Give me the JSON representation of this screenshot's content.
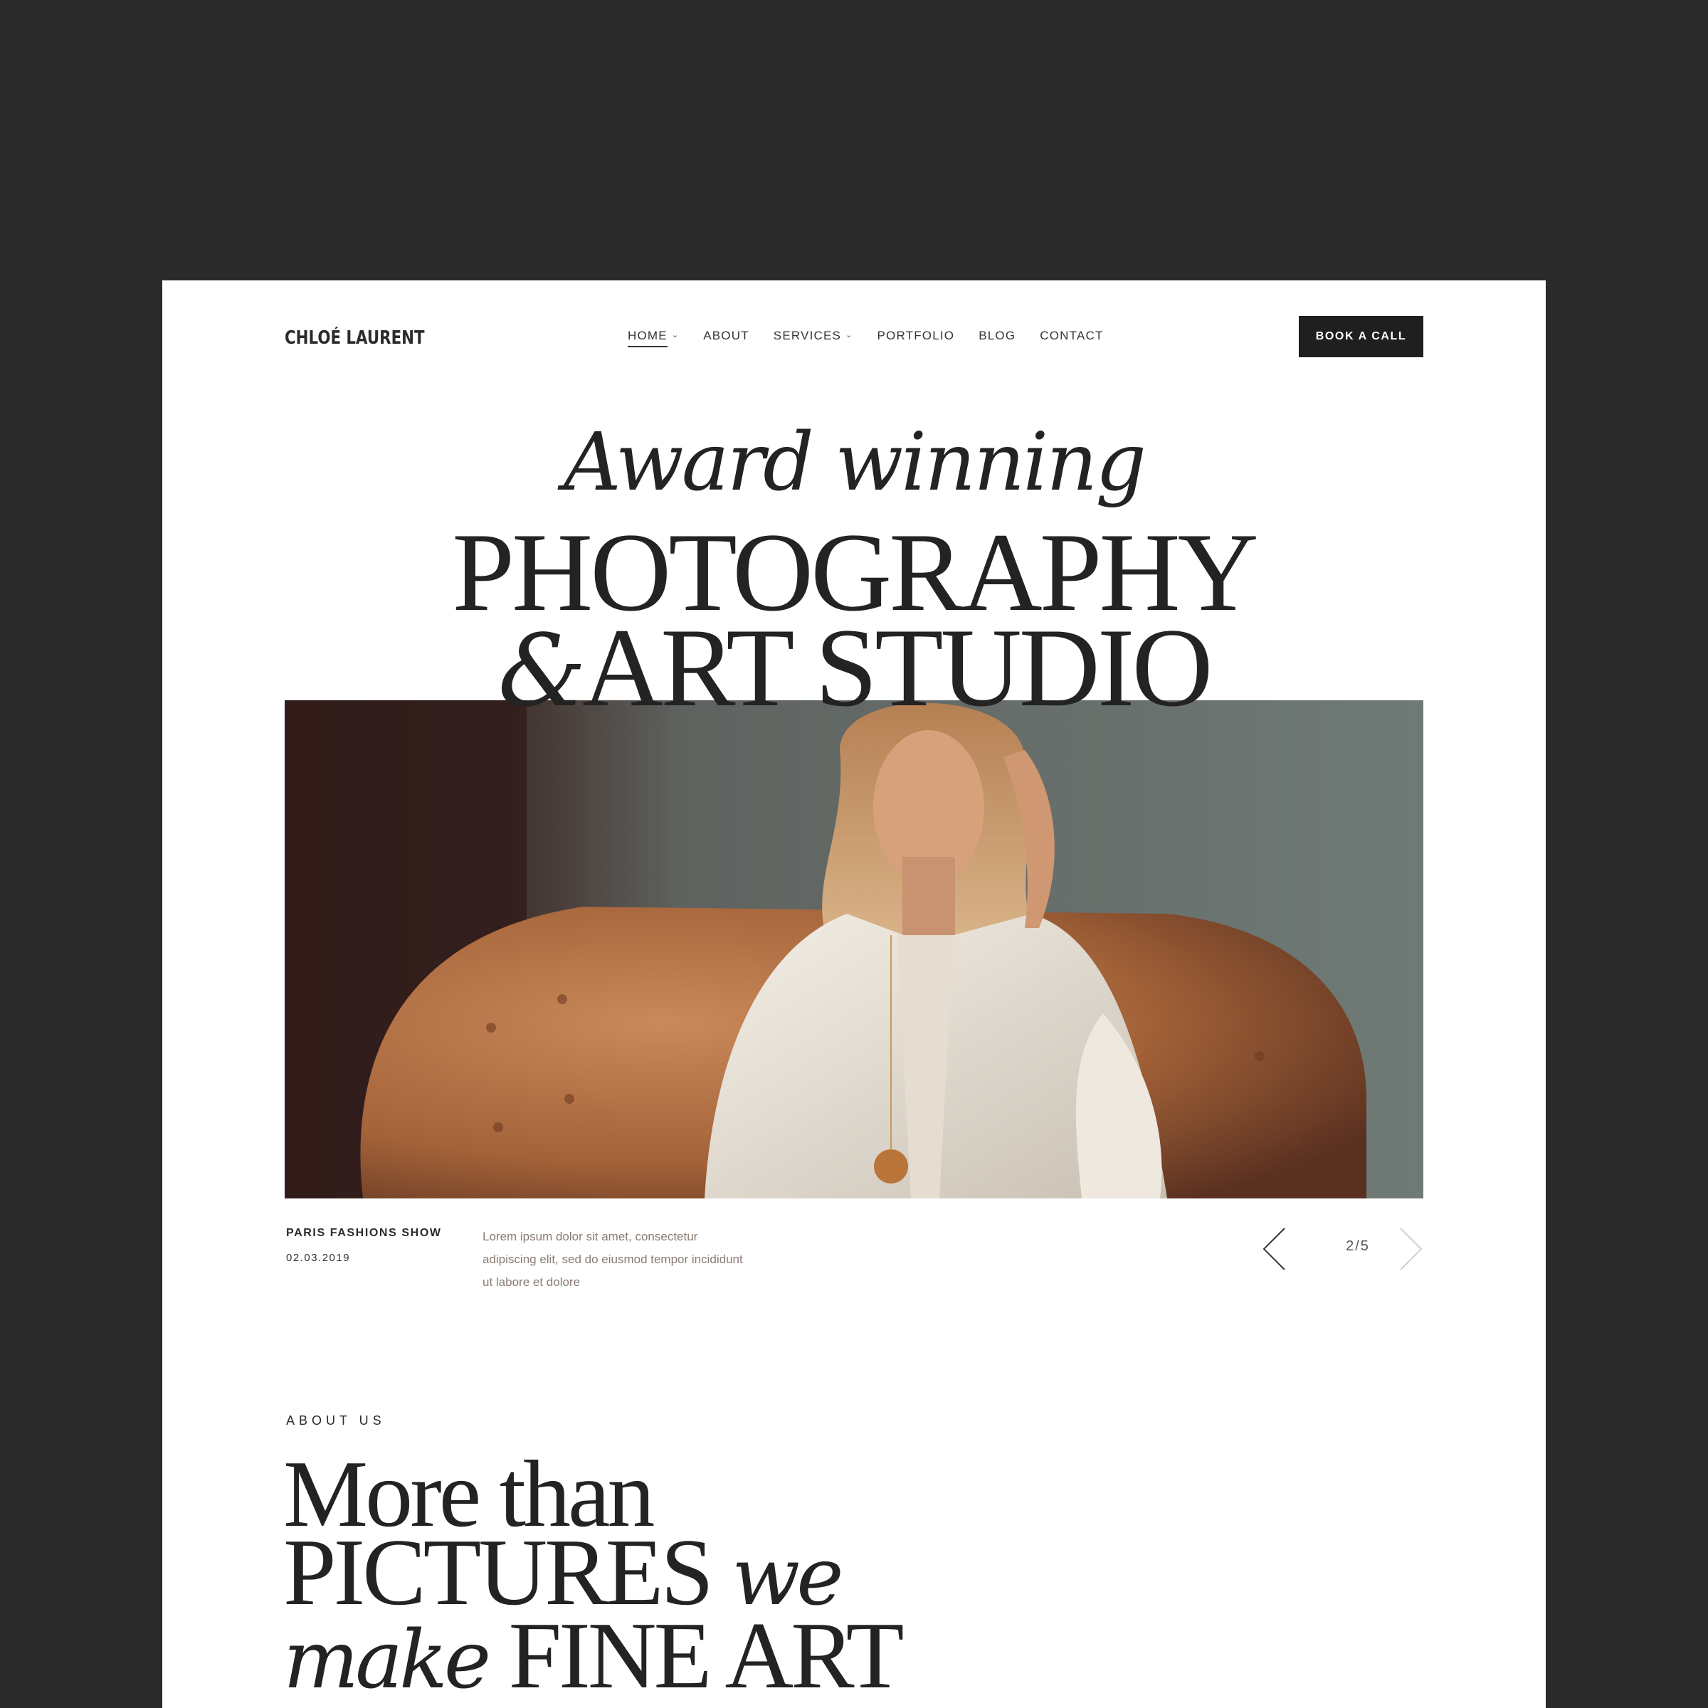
{
  "brand": "CHLOÉ LAURENT",
  "nav": [
    {
      "label": "HOME",
      "dropdown": true,
      "active": true
    },
    {
      "label": "ABOUT",
      "dropdown": false
    },
    {
      "label": "SERVICES",
      "dropdown": true
    },
    {
      "label": "PORTFOLIO",
      "dropdown": false
    },
    {
      "label": "BLOG",
      "dropdown": false
    },
    {
      "label": "CONTACT",
      "dropdown": false
    }
  ],
  "cta": "BOOK A CALL",
  "hero": {
    "italic": "Award winning",
    "line2": "PHOTOGRAPHY",
    "amp": "&",
    "line3": "ART STUDIO"
  },
  "caption": {
    "title": "PARIS FASHIONS SHOW",
    "date": "02.03.2019",
    "text": "Lorem ipsum dolor sit amet, consectetur adipiscing elit, sed do eiusmod tempor incididunt ut labore et dolore"
  },
  "slider": {
    "counter": "2/5"
  },
  "about": {
    "label": "ABOUT US",
    "l1": "More than",
    "l2a": "PICTURES",
    "l2b": "we",
    "l3a": "make",
    "l3b": "FINE ART"
  },
  "colors": {
    "background": "#2a2a2a",
    "page": "#ffffff",
    "text": "#232323",
    "button": "#1f1f1f",
    "muted": "#8a7b74"
  },
  "icons": [
    "chevron-down-icon",
    "arrow-left-icon",
    "arrow-right-icon"
  ]
}
